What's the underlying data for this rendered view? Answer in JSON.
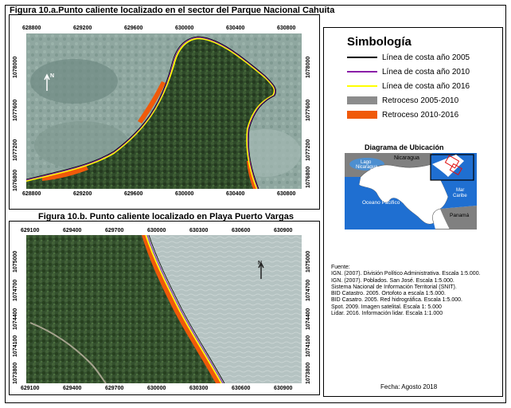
{
  "figure_a": {
    "title": "Figura 10.a.Punto caliente localizado en el sector  del Parque Nacional Cahuita",
    "x_ticks_top": [
      "628800",
      "629200",
      "629600",
      "630000",
      "630400",
      "630800"
    ],
    "x_ticks_bottom": [
      "628800",
      "629200",
      "629600",
      "630000",
      "630400",
      "630800"
    ],
    "y_ticks_left": [
      "1078000",
      "1077600",
      "1077200",
      "1076800"
    ],
    "y_ticks_right": [
      "1078000",
      "1077600",
      "1077200",
      "1076800"
    ],
    "north_label": "N"
  },
  "figure_b": {
    "title": "Figura 10.b. Punto caliente localizado en Playa Puerto Vargas",
    "x_ticks_top": [
      "629100",
      "629400",
      "629700",
      "630000",
      "630300",
      "630600",
      "630900"
    ],
    "x_ticks_bottom": [
      "629100",
      "629400",
      "629700",
      "630000",
      "630300",
      "630600",
      "630900"
    ],
    "y_ticks_left": [
      "1075000",
      "1074700",
      "1074400",
      "1074100",
      "1073800"
    ],
    "y_ticks_right": [
      "1075000",
      "1074700",
      "1074400",
      "1074100",
      "1073800"
    ],
    "north_label": "N"
  },
  "legend": {
    "title": "Simbología",
    "items": [
      {
        "label": "Línea de costa año 2005",
        "color": "#000000",
        "kind": "line"
      },
      {
        "label": "Línea de costa año 2010",
        "color": "#8a1fa8",
        "kind": "line"
      },
      {
        "label": "Línea de costa año  2016",
        "color": "#ffff00",
        "kind": "line"
      },
      {
        "label": "Retroceso 2005-2010",
        "color": "#8c8c8c",
        "kind": "fill"
      },
      {
        "label": "Retroceso 2010-2016",
        "color": "#f05a0a",
        "kind": "fill"
      }
    ]
  },
  "location_map": {
    "title": "Diagrama de Ubicación",
    "labels": {
      "lake": "Lago\nNicaragua",
      "nicaragua": "Nicaragua",
      "caribbean": "Mar\nCaribe",
      "pacific": "Oceano Pacifico",
      "panama": "Panamá"
    }
  },
  "sources": [
    "Fuente:",
    "IGN. (2007). División Político Administrativa. Escala 1:5.000.",
    "IGN. (2007). Poblados. San José. Escala 1:5.000.",
    "Sistema Nacional de Información Territorial (SNIT).",
    "BID Catastro. 2005. Ortofoto a escala 1:5.000.",
    "BID Casatro. 2005. Red hidrográfica. Escala 1:5.000.",
    "Spot. 2009. Imagen satelital. Escala 1: 5.000",
    "Lidar. 2016. Información lidar. Escala 1:1.000"
  ],
  "date": "Fecha: Agosto 2018",
  "colors": {
    "coast_2005": "#000000",
    "coast_2010": "#8a1fa8",
    "coast_2016": "#ffff00",
    "retreat_2005_2010": "#8c8c8c",
    "retreat_2010_2016": "#f05a0a",
    "forest": "#2f4a2a",
    "sea": "#8fa7a0"
  }
}
